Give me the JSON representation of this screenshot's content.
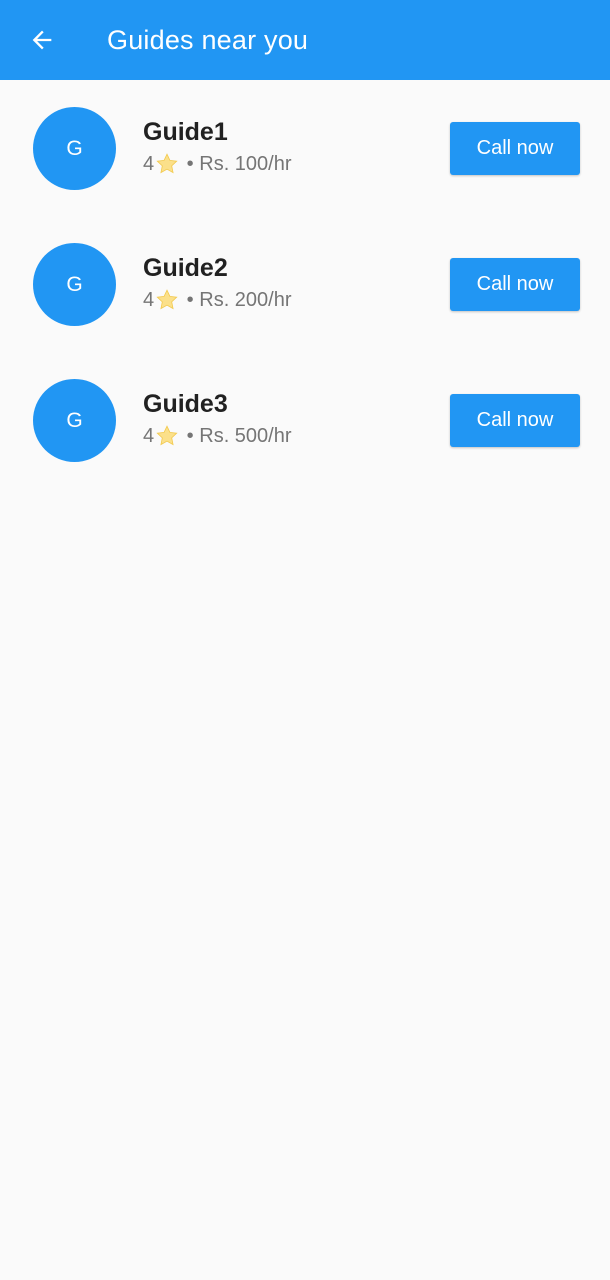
{
  "appbar": {
    "title": "Guides near you",
    "back_icon": "arrow-back-icon",
    "color": "#2196f3"
  },
  "guides": [
    {
      "avatar_letter": "G",
      "name": "Guide1",
      "rating": "4",
      "rating_icon": "star-icon",
      "separator": " • ",
      "price": "Rs. 100/hr",
      "button_label": "Call now"
    },
    {
      "avatar_letter": "G",
      "name": "Guide2",
      "rating": "4",
      "rating_icon": "star-icon",
      "separator": " • ",
      "price": "Rs. 200/hr",
      "button_label": "Call now"
    },
    {
      "avatar_letter": "G",
      "name": "Guide3",
      "rating": "4",
      "rating_icon": "star-icon",
      "separator": " • ",
      "price": "Rs. 500/hr",
      "button_label": "Call now"
    }
  ]
}
